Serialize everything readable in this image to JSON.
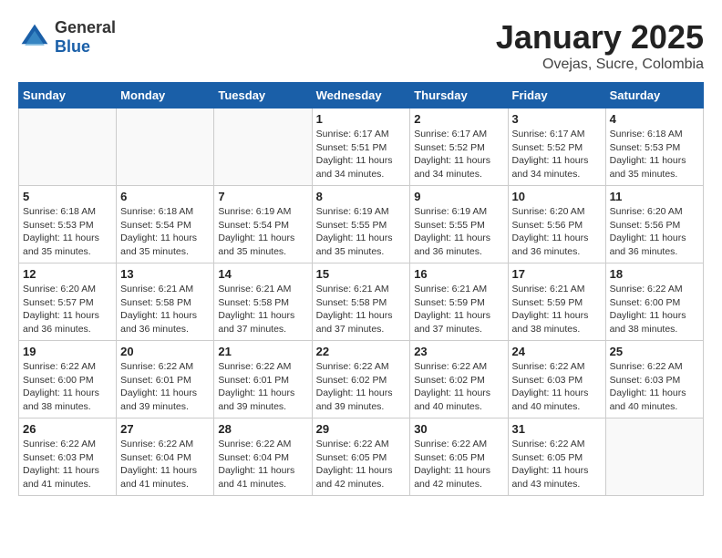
{
  "header": {
    "logo_general": "General",
    "logo_blue": "Blue",
    "month_title": "January 2025",
    "location": "Ovejas, Sucre, Colombia"
  },
  "weekdays": [
    "Sunday",
    "Monday",
    "Tuesday",
    "Wednesday",
    "Thursday",
    "Friday",
    "Saturday"
  ],
  "weeks": [
    [
      {
        "day": "",
        "info": ""
      },
      {
        "day": "",
        "info": ""
      },
      {
        "day": "",
        "info": ""
      },
      {
        "day": "1",
        "info": "Sunrise: 6:17 AM\nSunset: 5:51 PM\nDaylight: 11 hours and 34 minutes."
      },
      {
        "day": "2",
        "info": "Sunrise: 6:17 AM\nSunset: 5:52 PM\nDaylight: 11 hours and 34 minutes."
      },
      {
        "day": "3",
        "info": "Sunrise: 6:17 AM\nSunset: 5:52 PM\nDaylight: 11 hours and 34 minutes."
      },
      {
        "day": "4",
        "info": "Sunrise: 6:18 AM\nSunset: 5:53 PM\nDaylight: 11 hours and 35 minutes."
      }
    ],
    [
      {
        "day": "5",
        "info": "Sunrise: 6:18 AM\nSunset: 5:53 PM\nDaylight: 11 hours and 35 minutes."
      },
      {
        "day": "6",
        "info": "Sunrise: 6:18 AM\nSunset: 5:54 PM\nDaylight: 11 hours and 35 minutes."
      },
      {
        "day": "7",
        "info": "Sunrise: 6:19 AM\nSunset: 5:54 PM\nDaylight: 11 hours and 35 minutes."
      },
      {
        "day": "8",
        "info": "Sunrise: 6:19 AM\nSunset: 5:55 PM\nDaylight: 11 hours and 35 minutes."
      },
      {
        "day": "9",
        "info": "Sunrise: 6:19 AM\nSunset: 5:55 PM\nDaylight: 11 hours and 36 minutes."
      },
      {
        "day": "10",
        "info": "Sunrise: 6:20 AM\nSunset: 5:56 PM\nDaylight: 11 hours and 36 minutes."
      },
      {
        "day": "11",
        "info": "Sunrise: 6:20 AM\nSunset: 5:56 PM\nDaylight: 11 hours and 36 minutes."
      }
    ],
    [
      {
        "day": "12",
        "info": "Sunrise: 6:20 AM\nSunset: 5:57 PM\nDaylight: 11 hours and 36 minutes."
      },
      {
        "day": "13",
        "info": "Sunrise: 6:21 AM\nSunset: 5:58 PM\nDaylight: 11 hours and 36 minutes."
      },
      {
        "day": "14",
        "info": "Sunrise: 6:21 AM\nSunset: 5:58 PM\nDaylight: 11 hours and 37 minutes."
      },
      {
        "day": "15",
        "info": "Sunrise: 6:21 AM\nSunset: 5:58 PM\nDaylight: 11 hours and 37 minutes."
      },
      {
        "day": "16",
        "info": "Sunrise: 6:21 AM\nSunset: 5:59 PM\nDaylight: 11 hours and 37 minutes."
      },
      {
        "day": "17",
        "info": "Sunrise: 6:21 AM\nSunset: 5:59 PM\nDaylight: 11 hours and 38 minutes."
      },
      {
        "day": "18",
        "info": "Sunrise: 6:22 AM\nSunset: 6:00 PM\nDaylight: 11 hours and 38 minutes."
      }
    ],
    [
      {
        "day": "19",
        "info": "Sunrise: 6:22 AM\nSunset: 6:00 PM\nDaylight: 11 hours and 38 minutes."
      },
      {
        "day": "20",
        "info": "Sunrise: 6:22 AM\nSunset: 6:01 PM\nDaylight: 11 hours and 39 minutes."
      },
      {
        "day": "21",
        "info": "Sunrise: 6:22 AM\nSunset: 6:01 PM\nDaylight: 11 hours and 39 minutes."
      },
      {
        "day": "22",
        "info": "Sunrise: 6:22 AM\nSunset: 6:02 PM\nDaylight: 11 hours and 39 minutes."
      },
      {
        "day": "23",
        "info": "Sunrise: 6:22 AM\nSunset: 6:02 PM\nDaylight: 11 hours and 40 minutes."
      },
      {
        "day": "24",
        "info": "Sunrise: 6:22 AM\nSunset: 6:03 PM\nDaylight: 11 hours and 40 minutes."
      },
      {
        "day": "25",
        "info": "Sunrise: 6:22 AM\nSunset: 6:03 PM\nDaylight: 11 hours and 40 minutes."
      }
    ],
    [
      {
        "day": "26",
        "info": "Sunrise: 6:22 AM\nSunset: 6:03 PM\nDaylight: 11 hours and 41 minutes."
      },
      {
        "day": "27",
        "info": "Sunrise: 6:22 AM\nSunset: 6:04 PM\nDaylight: 11 hours and 41 minutes."
      },
      {
        "day": "28",
        "info": "Sunrise: 6:22 AM\nSunset: 6:04 PM\nDaylight: 11 hours and 41 minutes."
      },
      {
        "day": "29",
        "info": "Sunrise: 6:22 AM\nSunset: 6:05 PM\nDaylight: 11 hours and 42 minutes."
      },
      {
        "day": "30",
        "info": "Sunrise: 6:22 AM\nSunset: 6:05 PM\nDaylight: 11 hours and 42 minutes."
      },
      {
        "day": "31",
        "info": "Sunrise: 6:22 AM\nSunset: 6:05 PM\nDaylight: 11 hours and 43 minutes."
      },
      {
        "day": "",
        "info": ""
      }
    ]
  ]
}
